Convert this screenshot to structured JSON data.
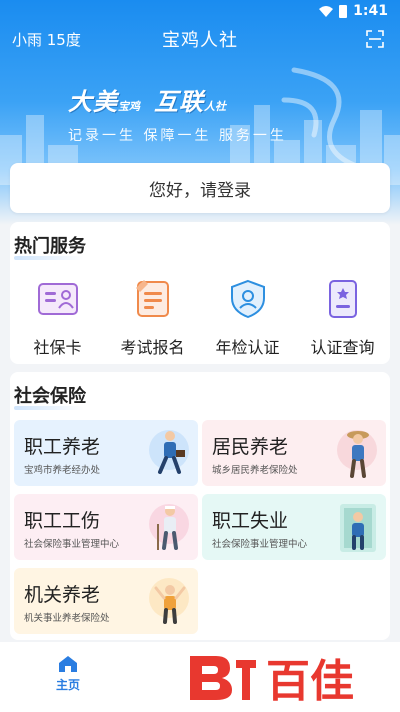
{
  "status": {
    "time": "1:41"
  },
  "header": {
    "weather": "小雨 15度",
    "title": "宝鸡人社"
  },
  "banner": {
    "slogan_a": "大美",
    "slogan_a_small": "宝鸡",
    "slogan_b": "互联",
    "slogan_b_small": "人社",
    "subline": "记录一生 保障一生 服务一生"
  },
  "login": {
    "prompt": "您好，请登录"
  },
  "hot_services": {
    "title": "热门服务",
    "items": [
      {
        "label": "社保卡",
        "icon": "id-card-icon"
      },
      {
        "label": "考试报名",
        "icon": "exam-registration-icon"
      },
      {
        "label": "年检认证",
        "icon": "shield-check-icon"
      },
      {
        "label": "认证查询",
        "icon": "certificate-query-icon"
      }
    ]
  },
  "social_insurance": {
    "title": "社会保险",
    "tiles": [
      {
        "title": "职工养老",
        "subtitle": "宝鸡市养老经办处",
        "bg": "#e6f2fe"
      },
      {
        "title": "居民养老",
        "subtitle": "城乡居民养老保险处",
        "bg": "#fdeef0"
      },
      {
        "title": "职工工伤",
        "subtitle": "社会保险事业管理中心",
        "bg": "#fdeef3"
      },
      {
        "title": "职工失业",
        "subtitle": "社会保险事业管理中心",
        "bg": "#e5f8f5"
      },
      {
        "title": "机关养老",
        "subtitle": "机关事业养老保险处",
        "bg": "#fff5e3"
      }
    ]
  },
  "tabbar": {
    "home_label": "主页"
  },
  "watermark": {
    "text": "百佳"
  },
  "colors": {
    "accent": "#2a7de1",
    "banner": "#1a8cf0"
  }
}
